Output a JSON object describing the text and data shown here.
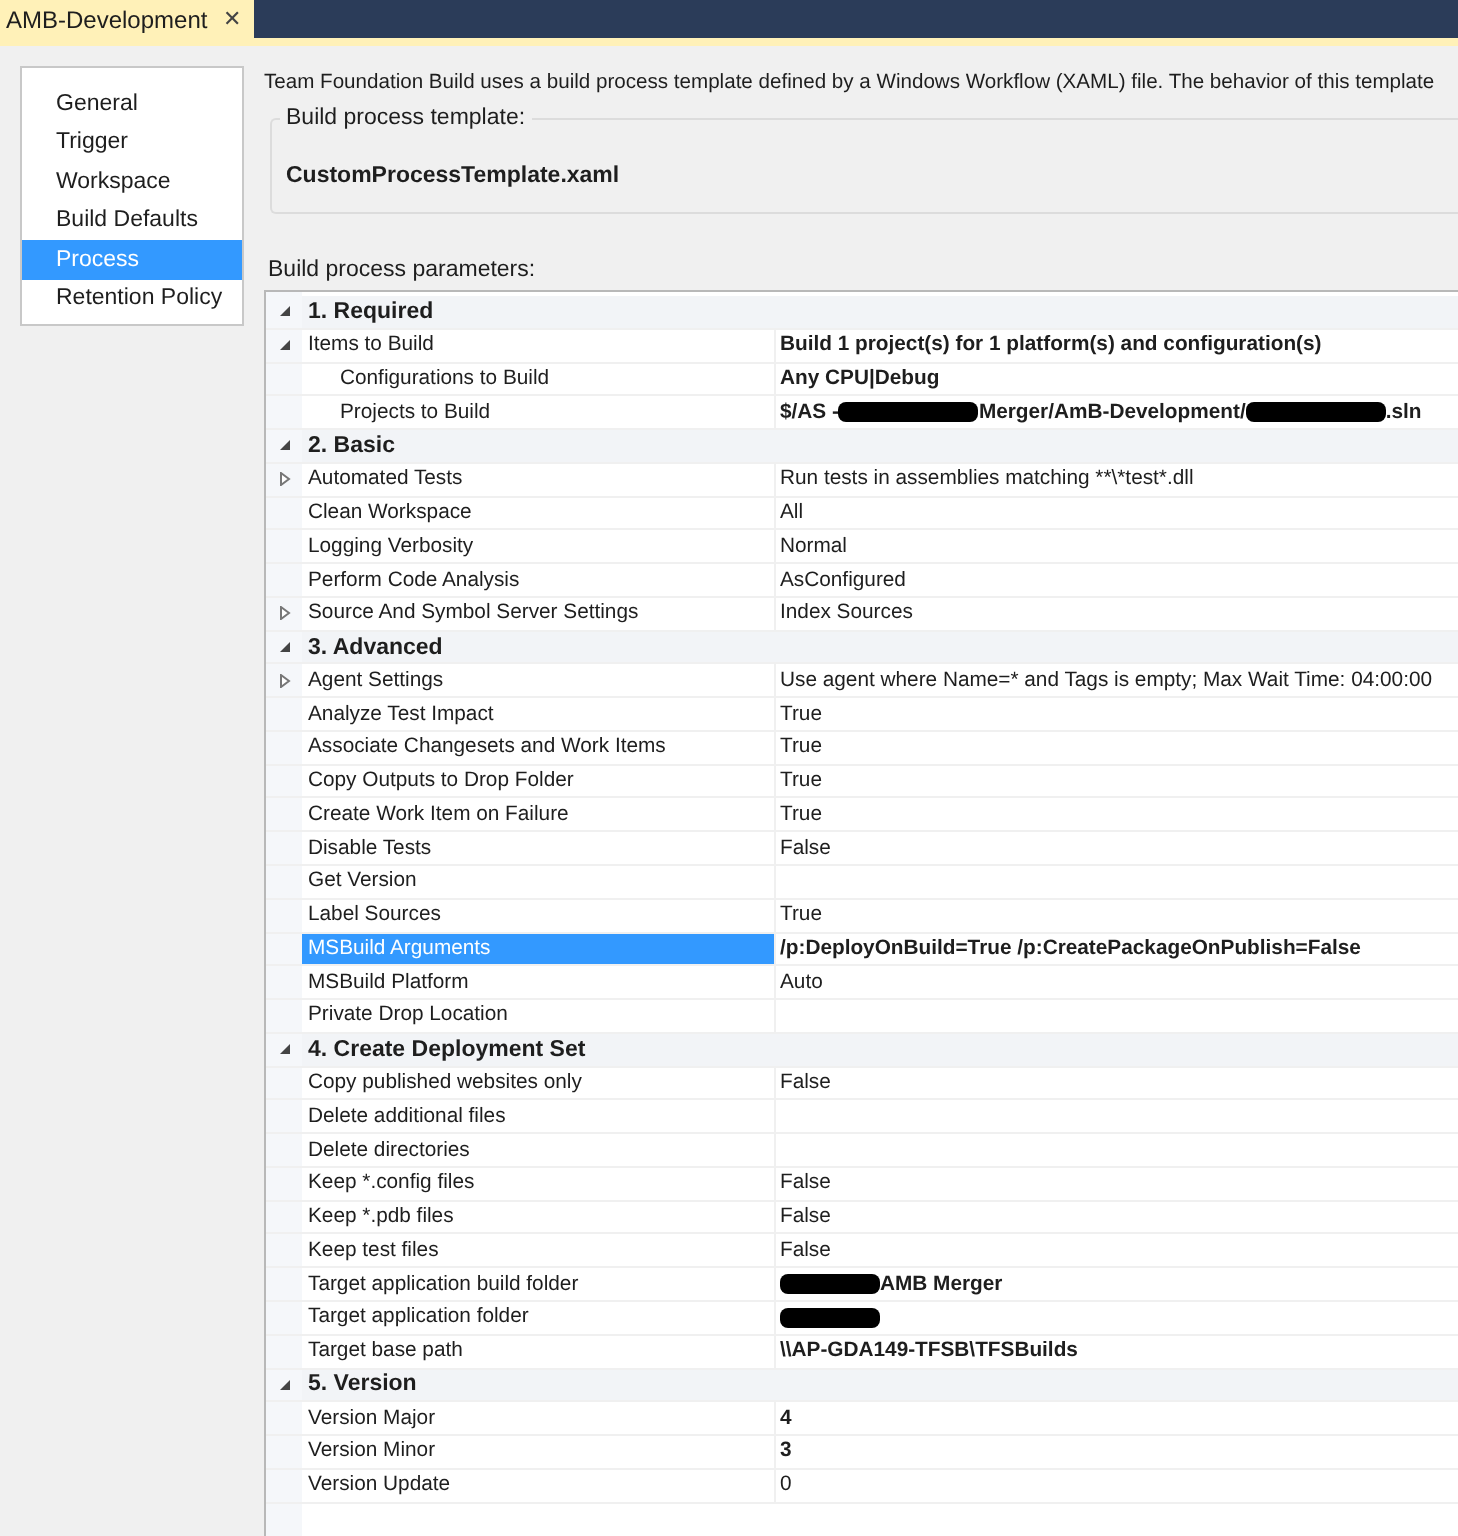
{
  "document_tab": {
    "title": "AMB-Development",
    "close": "✕"
  },
  "nav": [
    {
      "label": "General",
      "selected": false
    },
    {
      "label": "Trigger",
      "selected": false
    },
    {
      "label": "Workspace",
      "selected": false
    },
    {
      "label": "Build Defaults",
      "selected": false
    },
    {
      "label": "Process",
      "selected": true
    },
    {
      "label": "Retention Policy",
      "selected": false
    }
  ],
  "description": "Team Foundation Build uses a build process template defined by a Windows Workflow (XAML) file. The behavior of this template",
  "template_group": {
    "label": "Build process template:",
    "value": "CustomProcessTemplate.xaml"
  },
  "parameters_label": "Build process parameters:",
  "parameters": [
    {
      "category": "1. Required",
      "expanded": true,
      "items": [
        {
          "name": "Items to Build",
          "value": "Build 1 project(s) for 1 platform(s) and configuration(s)",
          "modified": true,
          "selected": false,
          "expanded": true,
          "children": [
            {
              "name": "Configurations to Build",
              "value": "Any CPU|Debug",
              "modified": true,
              "selected": false
            },
            {
              "name": "Projects to Build",
              "segments": [
                {
                  "kind": "text",
                  "text": "$/AS - "
                },
                {
                  "kind": "redacted"
                },
                {
                  "kind": "text",
                  "text": "Merger/AmB-Development/"
                },
                {
                  "kind": "redacted"
                },
                {
                  "kind": "text",
                  "text": ".sln"
                }
              ],
              "modified": true,
              "selected": false
            }
          ]
        }
      ]
    },
    {
      "category": "2. Basic",
      "expanded": true,
      "items": [
        {
          "name": "Automated Tests",
          "value": "Run tests in assemblies matching **\\*test*.dll",
          "modified": false,
          "selected": false,
          "expanded": false
        },
        {
          "name": "Clean Workspace",
          "value": "All",
          "modified": false,
          "selected": false
        },
        {
          "name": "Logging Verbosity",
          "value": "Normal",
          "modified": false,
          "selected": false
        },
        {
          "name": "Perform Code Analysis",
          "value": "AsConfigured",
          "modified": false,
          "selected": false
        },
        {
          "name": "Source And Symbol Server Settings",
          "value": "Index Sources",
          "modified": false,
          "selected": false,
          "expanded": false
        }
      ]
    },
    {
      "category": "3. Advanced",
      "expanded": true,
      "items": [
        {
          "name": "Agent Settings",
          "value": "Use agent where Name=* and Tags is empty; Max Wait Time: 04:00:00",
          "modified": false,
          "selected": false,
          "expanded": false
        },
        {
          "name": "Analyze Test Impact",
          "value": "True",
          "modified": false,
          "selected": false
        },
        {
          "name": "Associate Changesets and Work Items",
          "value": "True",
          "modified": false,
          "selected": false
        },
        {
          "name": "Copy Outputs to Drop Folder",
          "value": "True",
          "modified": false,
          "selected": false
        },
        {
          "name": "Create Work Item on Failure",
          "value": "True",
          "modified": false,
          "selected": false
        },
        {
          "name": "Disable Tests",
          "value": "False",
          "modified": false,
          "selected": false
        },
        {
          "name": "Get Version",
          "selected": false
        },
        {
          "name": "Label Sources",
          "value": "True",
          "modified": false,
          "selected": false
        },
        {
          "name": "MSBuild Arguments",
          "value": "/p:DeployOnBuild=True /p:CreatePackageOnPublish=False",
          "modified": true,
          "selected": true
        },
        {
          "name": "MSBuild Platform",
          "value": "Auto",
          "modified": false,
          "selected": false
        },
        {
          "name": "Private Drop Location",
          "selected": false
        }
      ]
    },
    {
      "category": "4. Create Deployment Set",
      "expanded": true,
      "items": [
        {
          "name": "Copy published websites only",
          "value": "False",
          "modified": false,
          "selected": false
        },
        {
          "name": "Delete additional files",
          "selected": false
        },
        {
          "name": "Delete directories",
          "selected": false
        },
        {
          "name": "Keep *.config files",
          "value": "False",
          "modified": false,
          "selected": false
        },
        {
          "name": "Keep *.pdb files",
          "value": "False",
          "modified": false,
          "selected": false
        },
        {
          "name": "Keep test files",
          "value": "False",
          "modified": false,
          "selected": false
        },
        {
          "name": "Target application build folder",
          "segments": [
            {
              "kind": "redacted"
            },
            {
              "kind": "text",
              "text": "AMB Merger"
            }
          ],
          "modified": true,
          "selected": false
        },
        {
          "name": "Target application folder",
          "segments": [
            {
              "kind": "redacted"
            }
          ],
          "modified": true,
          "selected": false
        },
        {
          "name": "Target base path",
          "value": "\\\\AP-GDA149-TFSB\\TFSBuilds",
          "modified": true,
          "selected": false
        }
      ]
    },
    {
      "category": "5. Version",
      "expanded": true,
      "items": [
        {
          "name": "Version Major",
          "value": "4",
          "modified": true,
          "selected": false
        },
        {
          "name": "Version Minor",
          "value": "3",
          "modified": true,
          "selected": false
        },
        {
          "name": "Version Update",
          "value": "0",
          "modified": false,
          "selected": false
        }
      ]
    }
  ]
}
